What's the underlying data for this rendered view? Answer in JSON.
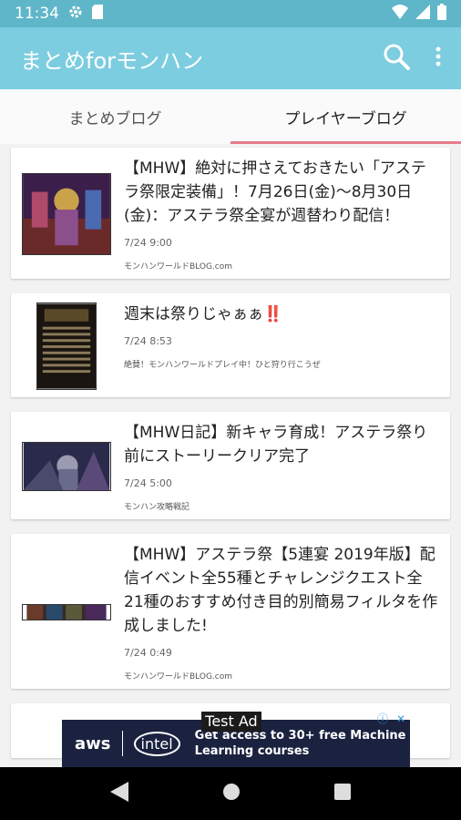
{
  "status": {
    "time": "11:34"
  },
  "app": {
    "title": "まとめforモンハン",
    "search_icon": "search-icon",
    "more_icon": "more-vert-icon"
  },
  "tabs": [
    {
      "label": "まとめブログ",
      "active": false
    },
    {
      "label": "プレイヤーブログ",
      "active": true
    }
  ],
  "posts": [
    {
      "title": "【MHW】絶対に押さえておきたい「アステラ祭限定装備」！7月26日(金)〜8月30日(金)：アステラ祭全宴が週替わり配信！",
      "time": "7/24 9:00",
      "source": "モンハンワールドBLOG.com"
    },
    {
      "title": "週末は祭りじゃぁぁ‼️",
      "time": "7/24 8:53",
      "source": "絶賛！モンハンワールドプレイ中！ひと狩り行こうぜ"
    },
    {
      "title": "【MHW日記】新キャラ育成！アステラ祭り前にストーリークリア完了",
      "time": "7/24 5:00",
      "source": "モンハン攻略戦記"
    },
    {
      "title": "【MHW】アステラ祭【5連宴 2019年版】配信イベント全55種とチャレンジクエスト全21種のおすすめ付き目的別簡易フィルタを作成しました!",
      "time": "7/24 0:49",
      "source": "モンハンワールドBLOG.com"
    }
  ],
  "ad": {
    "label": "Test Ad",
    "brand1": "aws",
    "brand2": "intel",
    "text_line1": "Get access to 30+ free Machine",
    "text_line2": "Learning courses"
  }
}
